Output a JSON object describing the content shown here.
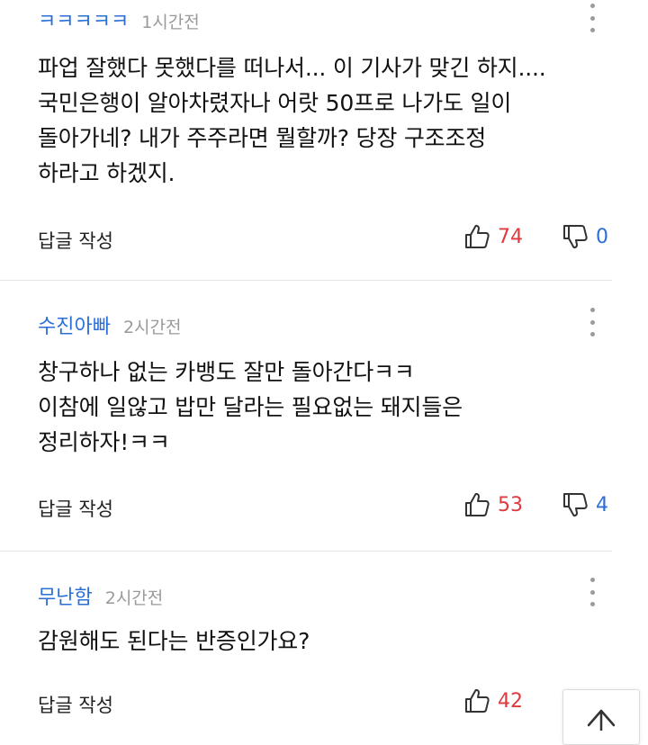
{
  "comments": [
    {
      "author": "ㅋㅋㅋㅋㅋ",
      "time": "1시간전",
      "lines": [
        "파업 잘했다 못했다를 떠나서... 이 기사가 맞긴 하지....",
        "국민은행이 알아차렸자나 어랏 50프로 나가도 일이",
        "돌아가네? 내가 주주라면 뭘할까? 당장 구조조정",
        "하라고 하겠지."
      ],
      "reply_label": "답글 작성",
      "likes": "74",
      "dislikes": "0"
    },
    {
      "author": "수진아빠",
      "time": "2시간전",
      "lines": [
        "창구하나 없는 카뱅도 잘만 돌아간다ㅋㅋ",
        "이참에 일않고 밥만 달라는 필요없는 돼지들은",
        "정리하자!ㅋㅋ"
      ],
      "reply_label": "답글 작성",
      "likes": "53",
      "dislikes": "4"
    },
    {
      "author": "무난함",
      "time": "2시간전",
      "lines": [
        "감원해도 된다는 반증인가요?"
      ],
      "reply_label": "답글 작성",
      "likes": "42",
      "dislikes": ""
    }
  ],
  "icons": {
    "more": "more-vertical-icon",
    "like": "thumbs-up-icon",
    "dislike": "thumbs-down-icon",
    "scroll_top": "arrow-up-icon"
  },
  "colors": {
    "author": "#2b6fd6",
    "like": "#e0393e",
    "dislike": "#2b6fd6"
  }
}
